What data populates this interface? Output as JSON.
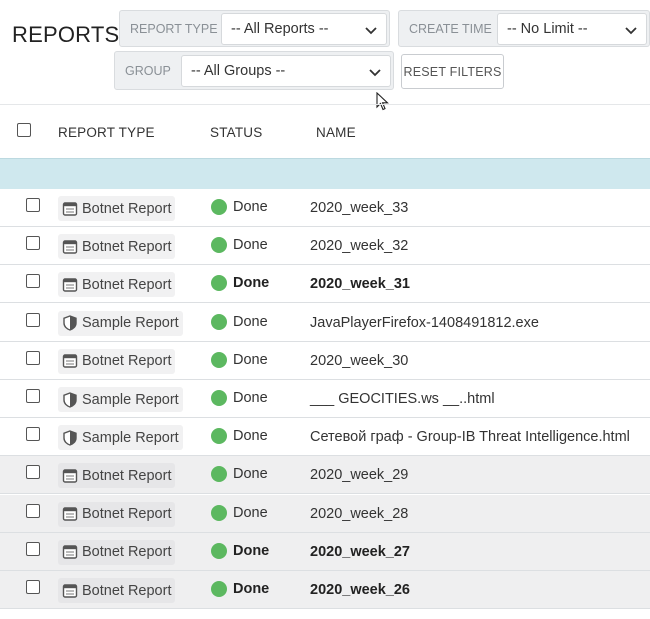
{
  "header": {
    "title": "REPORTS"
  },
  "filters": {
    "report_type": {
      "label": "REPORT TYPE",
      "value": "-- All Reports --"
    },
    "create_time": {
      "label": "CREATE TIME",
      "value": "-- No Limit --"
    },
    "group": {
      "label": "GROUP",
      "value": "-- All Groups --"
    },
    "reset_label": "RESET FILTERS"
  },
  "table": {
    "columns": {
      "type": "REPORT TYPE",
      "status": "STATUS",
      "name": "NAME"
    },
    "rows": [
      {
        "type": "Botnet Report",
        "icon": "calendar-icon",
        "status": "Done",
        "name": "2020_week_33",
        "bold": false,
        "shaded": false
      },
      {
        "type": "Botnet Report",
        "icon": "calendar-icon",
        "status": "Done",
        "name": "2020_week_32",
        "bold": false,
        "shaded": false
      },
      {
        "type": "Botnet Report",
        "icon": "calendar-icon",
        "status": "Done",
        "name": "2020_week_31",
        "bold": true,
        "shaded": false
      },
      {
        "type": "Sample Report",
        "icon": "shield-icon",
        "status": "Done",
        "name": "JavaPlayerFirefox-1408491812.exe",
        "bold": false,
        "shaded": false
      },
      {
        "type": "Botnet Report",
        "icon": "calendar-icon",
        "status": "Done",
        "name": "2020_week_30",
        "bold": false,
        "shaded": false
      },
      {
        "type": "Sample Report",
        "icon": "shield-icon",
        "status": "Done",
        "name": "___ GEOCITIES.ws __..html",
        "bold": false,
        "shaded": false
      },
      {
        "type": "Sample Report",
        "icon": "shield-icon",
        "status": "Done",
        "name": "Сетевой граф - Group-IB Threat Intelligence.html",
        "bold": false,
        "shaded": false
      },
      {
        "type": "Botnet Report",
        "icon": "calendar-icon",
        "status": "Done",
        "name": "2020_week_29",
        "bold": false,
        "shaded": true
      },
      {
        "type": "Botnet Report",
        "icon": "calendar-icon",
        "status": "Done",
        "name": "2020_week_28",
        "bold": false,
        "shaded": true
      },
      {
        "type": "Botnet Report",
        "icon": "calendar-icon",
        "status": "Done",
        "name": "2020_week_27",
        "bold": true,
        "shaded": true
      },
      {
        "type": "Botnet Report",
        "icon": "calendar-icon",
        "status": "Done",
        "name": "2020_week_26",
        "bold": true,
        "shaded": true
      }
    ]
  },
  "colors": {
    "status_done": "#5cb860",
    "band": "#cfe8ee"
  }
}
